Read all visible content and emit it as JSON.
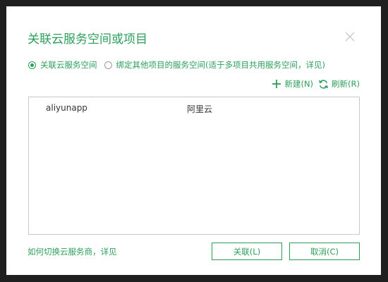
{
  "dialog": {
    "title": "关联云服务空间或项目"
  },
  "radio": {
    "option1": "关联云服务空间",
    "option2": "绑定其他项目的服务空间",
    "option2_hint": "(适于多项目共用服务空间，详见)",
    "selected": "option1"
  },
  "toolbar": {
    "new_label": "新建(N)",
    "refresh_label": "刷新(R)"
  },
  "list": {
    "rows": [
      {
        "name": "aliyunapp",
        "provider": "阿里云"
      }
    ]
  },
  "footer": {
    "help_text": "如何切换云服务商，详见",
    "ok_label": "关联(L)",
    "cancel_label": "取消(C)"
  },
  "colors": {
    "accent": "#2b9e5a",
    "backdrop": "#1f1f1f"
  }
}
